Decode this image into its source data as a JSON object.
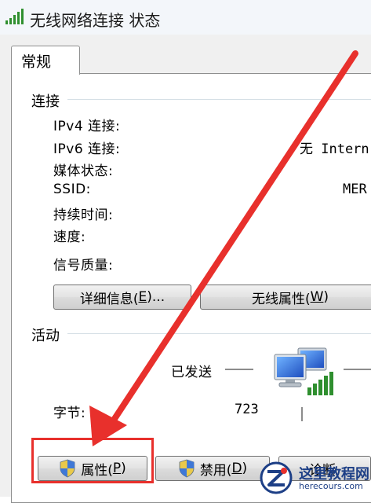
{
  "window": {
    "title": "无线网络连接 状态",
    "icon": "wireless-signal-icon"
  },
  "tabs": [
    {
      "label": "常规",
      "selected": true
    }
  ],
  "connection": {
    "title": "连接",
    "rows": [
      {
        "label": "IPv4 连接:",
        "value": ""
      },
      {
        "label": "IPv6 连接:",
        "value": "无 Intern"
      },
      {
        "label": "媒体状态:",
        "value": ""
      },
      {
        "label": "SSID:",
        "value": "MER"
      },
      {
        "label": "持续时间:",
        "value": ""
      },
      {
        "label": "速度:",
        "value": ""
      }
    ],
    "signal_label": "信号质量:",
    "details_button": {
      "text": "详细信息(",
      "mnemonic": "E",
      "suffix": ")..."
    },
    "wireless_button": {
      "text": "无线属性(",
      "mnemonic": "W",
      "suffix": ")"
    }
  },
  "activity": {
    "title": "活动",
    "sent_label": "已发送",
    "bytes_label": "字节:",
    "bytes_sent": "723",
    "icon": "network-computers-icon"
  },
  "buttons": {
    "properties": {
      "text": "属性(",
      "mnemonic": "P",
      "suffix": ")"
    },
    "disable": {
      "text": "禁用(",
      "mnemonic": "D",
      "suffix": ")"
    },
    "diagnose": {
      "text": "诊断"
    }
  },
  "watermark": {
    "main": "这里教程网",
    "sub": "herecours.com"
  },
  "colors": {
    "annotation_red": "#e8302c",
    "signal_green": "#2f8f2f",
    "watermark_blue": "#1d3f86"
  }
}
